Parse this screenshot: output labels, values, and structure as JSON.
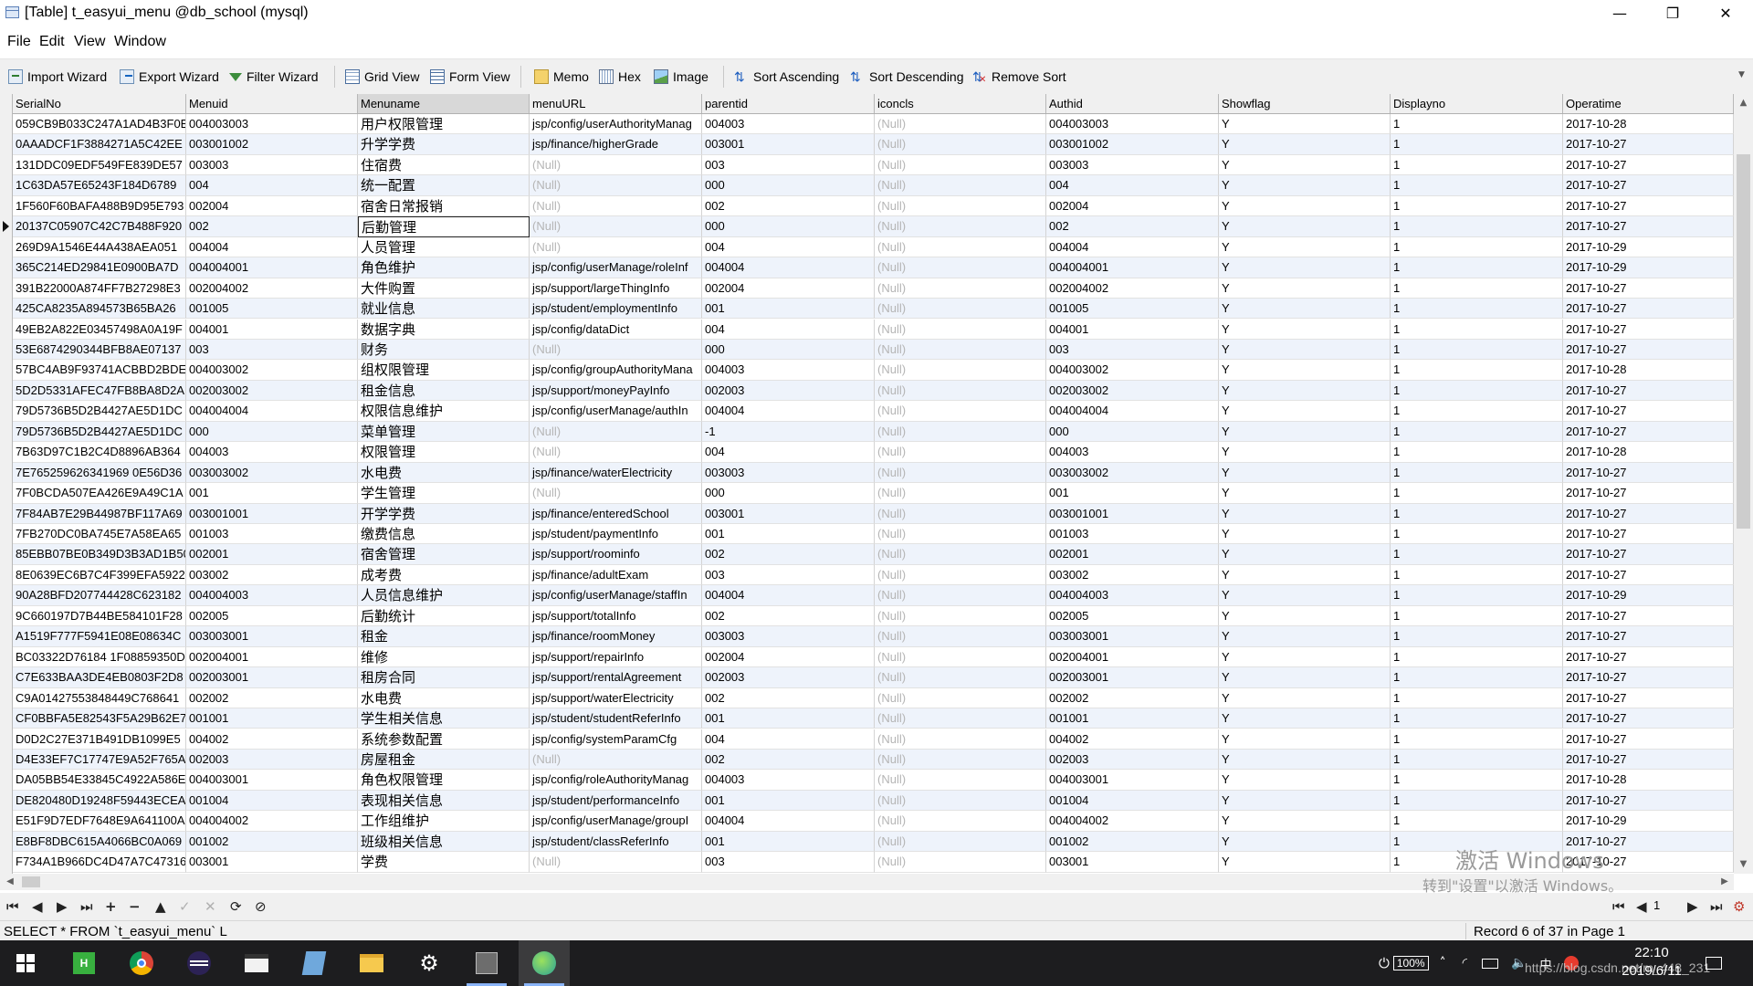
{
  "window": {
    "title": "[Table] t_easyui_menu @db_school (mysql)",
    "minimize": "—",
    "restore": "❐",
    "close": "✕"
  },
  "menu": [
    "File",
    "Edit",
    "View",
    "Window"
  ],
  "toolbar": {
    "import": "Import Wizard",
    "export": "Export Wizard",
    "filter": "Filter Wizard",
    "grid": "Grid View",
    "form": "Form View",
    "memo": "Memo",
    "hex": "Hex",
    "image": "Image",
    "sort_asc": "Sort Ascending",
    "sort_desc": "Sort Descending",
    "remove_sort": "Remove Sort"
  },
  "grid": {
    "columns": [
      "SerialNo",
      "Menuid",
      "Menuname",
      "menuURL",
      "parentid",
      "iconcls",
      "Authid",
      "Showflag",
      "Displayno",
      "Operatime"
    ],
    "sorted_column": 2,
    "current_row": 5,
    "rows": [
      [
        "059CB9B033C247A1AD4B3F0E",
        "004003003",
        "用户权限管理",
        "jsp/config/userAuthorityManag",
        "004003",
        "(Null)",
        "004003003",
        "Y",
        "1",
        "2017-10-28"
      ],
      [
        "0AAADCF1F3884271A5C42EE",
        "003001002",
        "升学学费",
        "jsp/finance/higherGrade",
        "003001",
        "(Null)",
        "003001002",
        "Y",
        "1",
        "2017-10-27"
      ],
      [
        "131DDC09EDF549FE839DE57",
        "003003",
        "住宿费",
        "(Null)",
        "003",
        "(Null)",
        "003003",
        "Y",
        "1",
        "2017-10-27"
      ],
      [
        "1C63DA57E65243F184D6789",
        "004",
        "统一配置",
        "(Null)",
        "000",
        "(Null)",
        "004",
        "Y",
        "1",
        "2017-10-27"
      ],
      [
        "1F560F60BAFA488B9D95E793",
        "002004",
        "宿舍日常报销",
        "(Null)",
        "002",
        "(Null)",
        "002004",
        "Y",
        "1",
        "2017-10-27"
      ],
      [
        "20137C05907C42C7B488F920",
        "002",
        "后勤管理",
        "(Null)",
        "000",
        "(Null)",
        "002",
        "Y",
        "1",
        "2017-10-27"
      ],
      [
        "269D9A1546E44A438AEA051",
        "004004",
        "人员管理",
        "(Null)",
        "004",
        "(Null)",
        "004004",
        "Y",
        "1",
        "2017-10-29"
      ],
      [
        "365C214ED29841E0900BA7D",
        "004004001",
        "角色维护",
        "jsp/config/userManage/roleInf",
        "004004",
        "(Null)",
        "004004001",
        "Y",
        "1",
        "2017-10-29"
      ],
      [
        "391B22000A874FF7B27298E3",
        "002004002",
        "大件购置",
        "jsp/support/largeThingInfo",
        "002004",
        "(Null)",
        "002004002",
        "Y",
        "1",
        "2017-10-27"
      ],
      [
        "425CA8235A894573B65BA26",
        "001005",
        "就业信息",
        "jsp/student/employmentInfo",
        "001",
        "(Null)",
        "001005",
        "Y",
        "1",
        "2017-10-27"
      ],
      [
        "49EB2A822E03457498A0A19F",
        "004001",
        "数据字典",
        "jsp/config/dataDict",
        "004",
        "(Null)",
        "004001",
        "Y",
        "1",
        "2017-10-27"
      ],
      [
        "53E6874290344BFB8AE07137",
        "003",
        "财务",
        "(Null)",
        "000",
        "(Null)",
        "003",
        "Y",
        "1",
        "2017-10-27"
      ],
      [
        "57BC4AB9F93741ACBBD2BDE",
        "004003002",
        "组权限管理",
        "jsp/config/groupAuthorityMana",
        "004003",
        "(Null)",
        "004003002",
        "Y",
        "1",
        "2017-10-28"
      ],
      [
        "5D2D5331AFEC47FB8BA8D2A",
        "002003002",
        "租金信息",
        "jsp/support/moneyPayInfo",
        "002003",
        "(Null)",
        "002003002",
        "Y",
        "1",
        "2017-10-27"
      ],
      [
        "79D5736B5D2B4427AE5D1DC",
        "004004004",
        "权限信息维护",
        "jsp/config/userManage/authIn",
        "004004",
        "(Null)",
        "004004004",
        "Y",
        "1",
        "2017-10-27"
      ],
      [
        "79D5736B5D2B4427AE5D1DC",
        "000",
        "菜单管理",
        "(Null)",
        "-1",
        "(Null)",
        "000",
        "Y",
        "1",
        "2017-10-27"
      ],
      [
        "7B63D97C1B2C4D8896AB364",
        "004003",
        "权限管理",
        "(Null)",
        "004",
        "(Null)",
        "004003",
        "Y",
        "1",
        "2017-10-28"
      ],
      [
        "7E765259626341969 0E56D36",
        "003003002",
        "水电费",
        "jsp/finance/waterElectricity",
        "003003",
        "(Null)",
        "003003002",
        "Y",
        "1",
        "2017-10-27"
      ],
      [
        "7F0BCDA507EA426E9A49C1A",
        "001",
        "学生管理",
        "(Null)",
        "000",
        "(Null)",
        "001",
        "Y",
        "1",
        "2017-10-27"
      ],
      [
        "7F84AB7E29B44987BF117A69",
        "003001001",
        "开学学费",
        "jsp/finance/enteredSchool",
        "003001",
        "(Null)",
        "003001001",
        "Y",
        "1",
        "2017-10-27"
      ],
      [
        "7FB270DC0BA745E7A58EA65",
        "001003",
        "缴费信息",
        "jsp/student/paymentInfo",
        "001",
        "(Null)",
        "001003",
        "Y",
        "1",
        "2017-10-27"
      ],
      [
        "85EBB07BE0B349D3B3AD1B50",
        "002001",
        "宿舍管理",
        "jsp/support/roominfo",
        "002",
        "(Null)",
        "002001",
        "Y",
        "1",
        "2017-10-27"
      ],
      [
        "8E0639EC6B7C4F399EFA5922",
        "003002",
        "成考费",
        "jsp/finance/adultExam",
        "003",
        "(Null)",
        "003002",
        "Y",
        "1",
        "2017-10-27"
      ],
      [
        "90A28BFD207744428C623182",
        "004004003",
        "人员信息维护",
        "jsp/config/userManage/staffIn",
        "004004",
        "(Null)",
        "004004003",
        "Y",
        "1",
        "2017-10-29"
      ],
      [
        "9C660197D7B44BE584101F28",
        "002005",
        "后勤统计",
        "jsp/support/totalInfo",
        "002",
        "(Null)",
        "002005",
        "Y",
        "1",
        "2017-10-27"
      ],
      [
        "A1519F777F5941E08E08634C",
        "003003001",
        "租金",
        "jsp/finance/roomMoney",
        "003003",
        "(Null)",
        "003003001",
        "Y",
        "1",
        "2017-10-27"
      ],
      [
        "BC03322D76184 1F08859350D",
        "002004001",
        "维修",
        "jsp/support/repairInfo",
        "002004",
        "(Null)",
        "002004001",
        "Y",
        "1",
        "2017-10-27"
      ],
      [
        "C7E633BAA3DE4EB0803F2D8",
        "002003001",
        "租房合同",
        "jsp/support/rentalAgreement",
        "002003",
        "(Null)",
        "002003001",
        "Y",
        "1",
        "2017-10-27"
      ],
      [
        "C9A01427553848449C768641",
        "002002",
        "水电费",
        "jsp/support/waterElectricity",
        "002",
        "(Null)",
        "002002",
        "Y",
        "1",
        "2017-10-27"
      ],
      [
        "CF0BBFA5E82543F5A29B62E7",
        "001001",
        "学生相关信息",
        "jsp/student/studentReferInfo",
        "001",
        "(Null)",
        "001001",
        "Y",
        "1",
        "2017-10-27"
      ],
      [
        "D0D2C27E371B491DB1099E5",
        "004002",
        "系统参数配置",
        "jsp/config/systemParamCfg",
        "004",
        "(Null)",
        "004002",
        "Y",
        "1",
        "2017-10-27"
      ],
      [
        "D4E33EF7C17747E9A52F765A",
        "002003",
        "房屋租金",
        "(Null)",
        "002",
        "(Null)",
        "002003",
        "Y",
        "1",
        "2017-10-27"
      ],
      [
        "DA05BB54E33845C4922A586E",
        "004003001",
        "角色权限管理",
        "jsp/config/roleAuthorityManag",
        "004003",
        "(Null)",
        "004003001",
        "Y",
        "1",
        "2017-10-28"
      ],
      [
        "DE820480D19248F59443ECEA",
        "001004",
        "表现相关信息",
        "jsp/student/performanceInfo",
        "001",
        "(Null)",
        "001004",
        "Y",
        "1",
        "2017-10-27"
      ],
      [
        "E51F9D7EDF7648E9A641100A",
        "004004002",
        "工作组维护",
        "jsp/config/userManage/groupI",
        "004004",
        "(Null)",
        "004004002",
        "Y",
        "1",
        "2017-10-29"
      ],
      [
        "E8BF8DBC615A4066BC0A069",
        "001002",
        "班级相关信息",
        "jsp/student/classReferInfo",
        "001",
        "(Null)",
        "001002",
        "Y",
        "1",
        "2017-10-27"
      ],
      [
        "F734A1B966DC4D47A7C47316",
        "003001",
        "学费",
        "(Null)",
        "003",
        "(Null)",
        "003001",
        "Y",
        "1",
        "2017-10-27"
      ]
    ]
  },
  "navigator": {
    "page": "1"
  },
  "status": {
    "sql": "SELECT * FROM `t_easyui_menu` L",
    "record": "Record 6 of 37 in Page 1"
  },
  "watermark": {
    "line1": "激活 Windows",
    "line2": "转到\"设置\"以激活 Windows。"
  },
  "taskbar": {
    "battery": "100%",
    "time": "22:10",
    "date": "2019/6/11",
    "url": "https://blog.csdn.net/m_448_231"
  },
  "colors": {
    "alt_row": "#eef3fb",
    "null_text": "#b5b5b5",
    "taskbar": "#1d1d1f"
  }
}
